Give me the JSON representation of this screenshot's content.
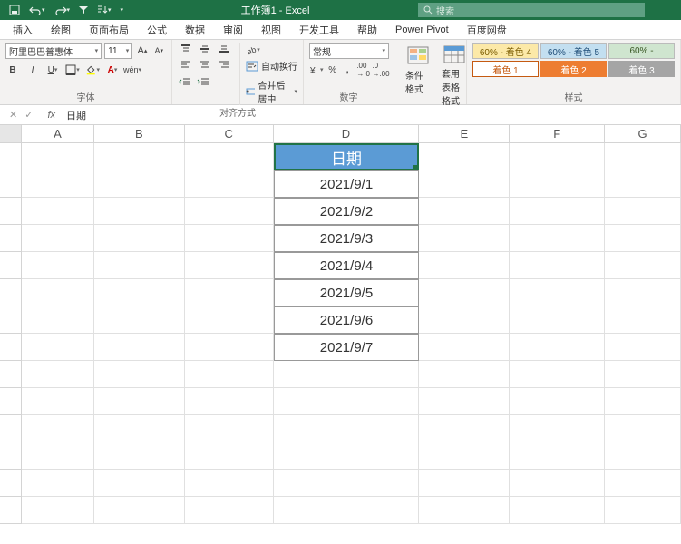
{
  "title": "工作簿1 - Excel",
  "search_placeholder": "搜索",
  "menu": [
    "插入",
    "绘图",
    "页面布局",
    "公式",
    "数据",
    "审阅",
    "视图",
    "开发工具",
    "帮助",
    "Power Pivot",
    "百度网盘"
  ],
  "ribbon": {
    "font_name": "阿里巴巴普惠体",
    "font_size": "11",
    "font_group": "字体",
    "align_group": "对齐方式",
    "wrap_label": "自动换行",
    "merge_label": "合并后居中",
    "number_group": "数字",
    "number_format": "常规",
    "cond_fmt": "条件格式",
    "table_fmt": "套用表格格式",
    "styles_group": "样式",
    "swatches": [
      "60% - 着色 4",
      "60% - 着色 5",
      "60% - ",
      "着色 1",
      "着色 2",
      "着色 3"
    ]
  },
  "formula_bar": {
    "value": "日期"
  },
  "columns": [
    "A",
    "B",
    "C",
    "D",
    "E",
    "F",
    "G"
  ],
  "cells": {
    "D1": "日期",
    "D2": "2021/9/1",
    "D3": "2021/9/2",
    "D4": "2021/9/3",
    "D5": "2021/9/4",
    "D6": "2021/9/5",
    "D7": "2021/9/6",
    "D8": "2021/9/7"
  }
}
